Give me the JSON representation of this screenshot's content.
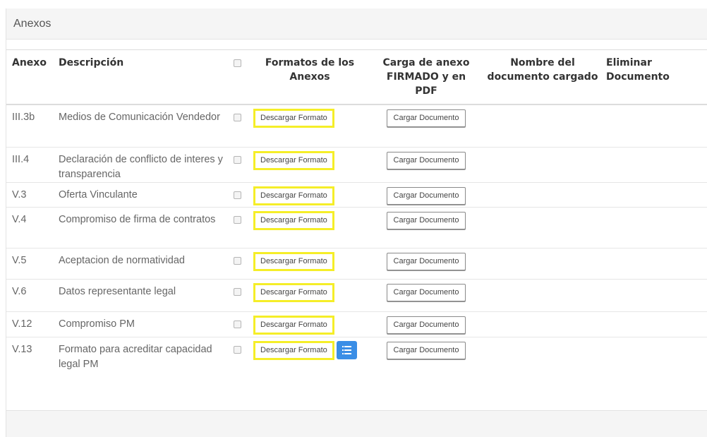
{
  "panel": {
    "title": "Anexos"
  },
  "table": {
    "headers": {
      "anexo": "Anexo",
      "descripcion": "Descripción",
      "formatos": "Formatos de los Anexos",
      "carga": "Carga de anexo FIRMADO y en PDF",
      "nombre": "Nombre del documento cargado",
      "eliminar": "Eliminar Documento"
    },
    "download_label": "Descargar Formato",
    "upload_label": "Cargar Documento",
    "rows": [
      {
        "anexo": "III.3b",
        "descripcion": "Medios de Comunicación Vendedor"
      },
      {
        "anexo": "III.4",
        "descripcion": "Declaración de conflicto de interes y transparencia"
      },
      {
        "anexo": "V.3",
        "descripcion": "Oferta Vinculante"
      },
      {
        "anexo": "V.4",
        "descripcion": "Compromiso de firma de contratos"
      },
      {
        "anexo": "V.5",
        "descripcion": "Aceptacion de normatividad"
      },
      {
        "anexo": "V.6",
        "descripcion": "Datos representante legal"
      },
      {
        "anexo": "V.12",
        "descripcion": "Compromiso PM"
      },
      {
        "anexo": "V.13",
        "descripcion": "Formato para acreditar capacidad legal PM"
      }
    ]
  },
  "colors": {
    "highlight": "#f5ee28",
    "accent": "#3a8ee6"
  },
  "icons": {
    "row_action": "list-icon"
  }
}
